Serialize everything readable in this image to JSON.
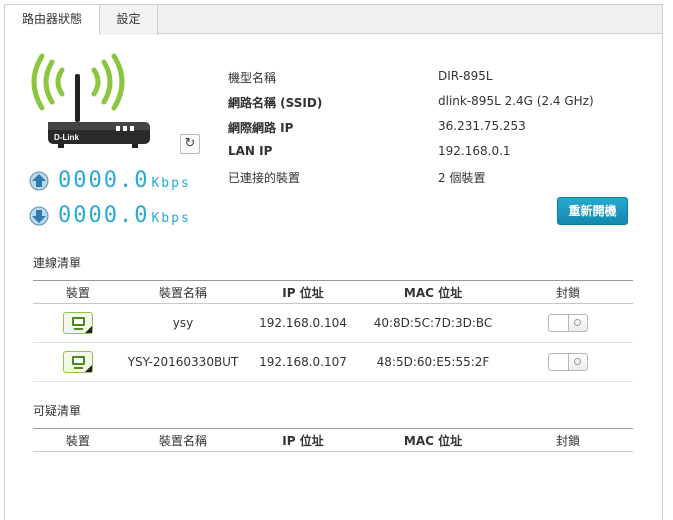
{
  "tabs": [
    {
      "label": "路由器狀態",
      "active": true
    },
    {
      "label": "設定",
      "active": false
    }
  ],
  "router": {
    "brand": "D-Link",
    "icons": {
      "wifi": "wifi-signal-icon",
      "refresh": "refresh-icon"
    }
  },
  "speed": {
    "upload": {
      "value": "0000.0",
      "unit": "Kbps",
      "icon": "upload-arrow-icon"
    },
    "download": {
      "value": "0000.0",
      "unit": "Kbps",
      "icon": "download-arrow-icon"
    }
  },
  "info": [
    {
      "label": "機型名稱",
      "value": "DIR-895L"
    },
    {
      "label": "網路名稱 (SSID)",
      "value": "dlink-895L 2.4G (2.4 GHz)"
    },
    {
      "label": "網際網路 IP",
      "value": "36.231.75.253"
    },
    {
      "label": "LAN IP",
      "value": "192.168.0.1"
    },
    {
      "label": "已連接的裝置",
      "value": "2 個裝置"
    }
  ],
  "reboot_label": "重新開機",
  "connected": {
    "title": "連線清單",
    "headers": [
      "裝置",
      "裝置名稱",
      "IP 位址",
      "MAC 位址",
      "封鎖"
    ],
    "rows": [
      {
        "name": "ysy",
        "ip": "192.168.0.104",
        "mac": "40:8D:5C:7D:3D:BC"
      },
      {
        "name": "YSY-20160330BUT",
        "ip": "192.168.0.107",
        "mac": "48:5D:60:E5:55:2F"
      }
    ]
  },
  "suspicious": {
    "title": "可疑清單",
    "headers": [
      "裝置",
      "裝置名稱",
      "IP 位址",
      "MAC 位址",
      "封鎖"
    ]
  },
  "colors": {
    "accent": "#29a9d6",
    "wifi_green": "#8cc63f",
    "button": "#1a9bc2"
  }
}
